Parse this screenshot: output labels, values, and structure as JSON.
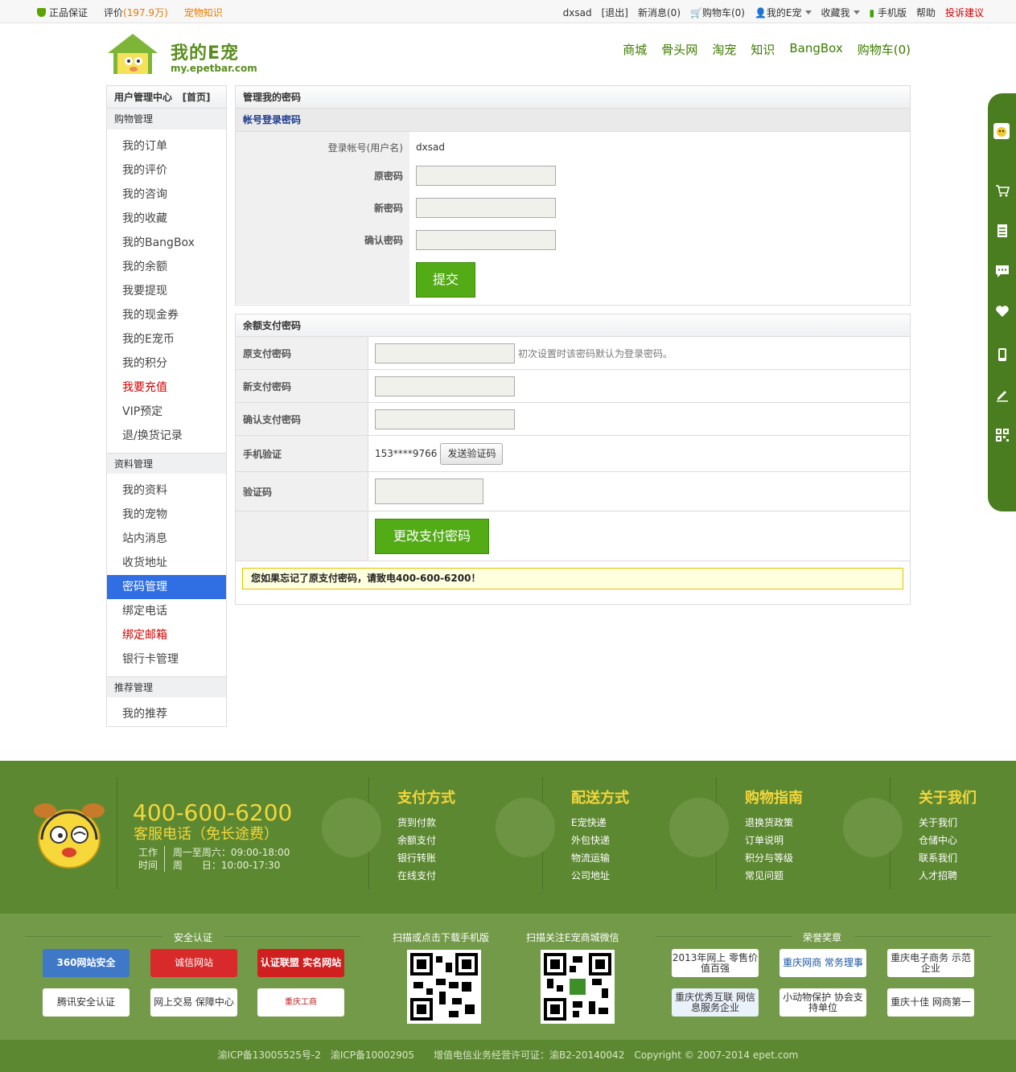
{
  "topbar": {
    "genuine": "正品保证",
    "reviews_label": "评价",
    "reviews_count": "(197.9万)",
    "pet_knowledge": "宠物知识",
    "username": "dxsad",
    "logout": "[退出]",
    "messages": "新消息(0)",
    "cart": "购物车(0)",
    "my_epet": "我的E宠",
    "favorites": "收藏我",
    "mobile": "手机版",
    "help": "帮助",
    "complaint": "投诉建议"
  },
  "header": {
    "logo_text": "我的E宠",
    "logo_url": "my.epetbar.com",
    "nav": [
      "商城",
      "骨头网",
      "淘宠",
      "知识",
      "BangBox",
      "购物车(0)"
    ]
  },
  "sidebar": {
    "title": "用户管理中心",
    "home": "[首页]",
    "sections": [
      {
        "title": "购物管理",
        "items": [
          "我的订单",
          "我的评价",
          "我的咨询",
          "我的收藏",
          "我的BangBox",
          "我的余额",
          "我要提现",
          "我的现金券",
          "我的E宠币",
          "我的积分",
          "我要充值",
          "VIP预定",
          "退/换货记录"
        ]
      },
      {
        "title": "资料管理",
        "items": [
          "我的资料",
          "我的宠物",
          "站内消息",
          "收货地址",
          "密码管理",
          "绑定电话",
          "绑定邮箱",
          "银行卡管理"
        ]
      },
      {
        "title": "推荐管理",
        "items": [
          "我的推荐"
        ]
      }
    ],
    "red_items": [
      "我要充值",
      "绑定邮箱"
    ],
    "active_item": "密码管理"
  },
  "login_password": {
    "panel_title": "管理我的密码",
    "sub_title": "帐号登录密码",
    "account_label": "登录帐号(用户名)",
    "account_value": "dxsad",
    "old_label": "原密码",
    "new_label": "新密码",
    "confirm_label": "确认密码",
    "submit": "提交"
  },
  "pay_password": {
    "panel_title": "余额支付密码",
    "old_label": "原支付密码",
    "old_hint": "初次设置时该密码默认为登录密码。",
    "new_label": "新支付密码",
    "confirm_label": "确认支付密码",
    "phone_label": "手机验证",
    "phone_value": "153****9766",
    "send_code": "发送验证码",
    "code_label": "验证码",
    "submit": "更改支付密码",
    "notice": "您如果忘记了原支付密码，请致电400-600-6200！"
  },
  "footer": {
    "phone": "400-600-6200",
    "phone_sub": "客服电话（免长途费）",
    "hours_label1": "工作",
    "hours_label2": "时间",
    "hours_line1": "周一至周六：09:00-18:00",
    "hours_line2": "周　　日：10:00-17:30",
    "columns": [
      {
        "title": "支付方式",
        "items": [
          "货到付款",
          "余额支付",
          "银行转账",
          "在线支付"
        ]
      },
      {
        "title": "配送方式",
        "items": [
          "E宠快递",
          "外包快递",
          "物流运输",
          "公司地址"
        ]
      },
      {
        "title": "购物指南",
        "items": [
          "退换货政策",
          "订单说明",
          "积分与等级",
          "常见问题"
        ]
      },
      {
        "title": "关于我们",
        "items": [
          "关于我们",
          "仓储中心",
          "联系我们",
          "人才招聘"
        ]
      }
    ],
    "security_title": "安全认证",
    "security_badges": [
      "360网站安全",
      "诚信网站",
      "认证联盟 实名网站",
      "腾讯安全认证",
      "网上交易 保障中心",
      "重庆工商"
    ],
    "qr_mobile_title": "扫描或点击下载手机版",
    "qr_wechat_title": "扫描关注E宠商城微信",
    "honors_title": "荣誉奖章",
    "honors": [
      "2013年网上 零售价值百强",
      "重庆网商 常务理事",
      "重庆电子商务 示范企业",
      "重庆优秀互联 网信息服务企业",
      "小动物保护 协会支持单位",
      "重庆十佳 网商第一"
    ],
    "copyright": "渝ICP备13005525号-2　渝ICP备10002905　　增值电信业务经营许可证：渝B2-20140042　Copyright © 2007-2014 epet.com"
  },
  "colors": {
    "brand_green": "#5d8832",
    "button_green": "#53ab16",
    "active_blue": "#2f6fe3",
    "accent_yellow": "#f3d63b",
    "alert_red": "#d50000"
  }
}
